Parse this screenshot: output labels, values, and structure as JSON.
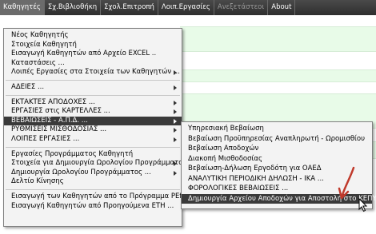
{
  "menubar": {
    "items": [
      {
        "label": "Καθηγητές"
      },
      {
        "label": "Σχ.Βιβλιοθήκη"
      },
      {
        "label": "Σχολ.Επιτροπή"
      },
      {
        "label": "Λοιπ.Εργασίες"
      },
      {
        "label": "Ανεξετάστεοι"
      },
      {
        "label": "About"
      }
    ]
  },
  "main_menu": {
    "group1": [
      {
        "label": "Νέος Καθηγητής"
      },
      {
        "label": "Στοιχεία Καθηγητή"
      },
      {
        "label": "Εισαγωγή Καθηγητών από Αρχείο  EXCEL .."
      },
      {
        "label": "Καταστάσεις ..."
      },
      {
        "label": "Λοιπές Εργασίες στα Στοιχεία των Καθηγητών ..."
      }
    ],
    "group2": [
      {
        "label": "ΑΔΕΙΕΣ ..."
      }
    ],
    "group3": [
      {
        "label": "ΕΚΤΑΚΤΕΣ ΑΠΟΔΟΧΕΣ ..."
      },
      {
        "label": "ΕΡΓΑΣΙΕΣ  στις  ΚΑΡΤΕΛΛΕΣ ..."
      },
      {
        "label": "ΒΕΒΑΙΩΣΕΙΣ  -  Α.Π.Δ. ..."
      },
      {
        "label": "ΡΥΘΜΙΣΕΙΣ  ΜΙΣΘΟΔΟΣΙΑΣ ..."
      },
      {
        "label": "ΛΟΙΠΕΣ  ΕΡΓΑΣΙΕΣ ..."
      }
    ],
    "group4": [
      {
        "label": "Εργασίες  Προγράμματος Καθηγητή"
      },
      {
        "label": "Στοιχεία για Δημιουργία Ωρολογίου Προγράμματος ..."
      },
      {
        "label": "Δημιουργία Ωρολογίου Προγράμματος ..."
      },
      {
        "label": "Δελτίο Κίνησης"
      }
    ],
    "group5": [
      {
        "label": "Εισαγωγή των Καθηγητών από το Πρόγραμμα PEforia"
      },
      {
        "label": "Εισαγωγή  Καθηγητών  από Προηγούμενα ΕΤΗ ..."
      }
    ]
  },
  "submenu": {
    "items": [
      {
        "label": "Υπηρεσιακή Βεβαίωση"
      },
      {
        "label": "Βεβαίωση Προϋπηρεσίας Αναπληρωτή - Ωρομισθίου"
      },
      {
        "label": "Βεβαίωση Αποδοχών"
      },
      {
        "label": "Διακοπή Μισθοδοσίας"
      },
      {
        "label": "Βεβαίωση-Δήλωση Εργοδότη για ΟΑΕΔ"
      },
      {
        "label": "ΑΝΑΛΥΤΙΚΗ  ΠΕΡΙΟΔΙΚΗ  ΔΗΛΩΣΗ  -  ΙΚΑ ..."
      },
      {
        "label": "ΦΟΡΟΛΟΓΙΚΕΣ  ΒΕΒΑΙΩΣΕΙΣ  ..."
      },
      {
        "label": "Δημιουργία Αρχείου Αποδοχών για Αποστολή στο ΚΕΠΥΟ"
      }
    ]
  },
  "colors": {
    "menubar": "#3a3a3a",
    "highlight": "#3a3a3a",
    "background_band": "#e8fbe8",
    "annotation_arrow": "#c0392b"
  }
}
